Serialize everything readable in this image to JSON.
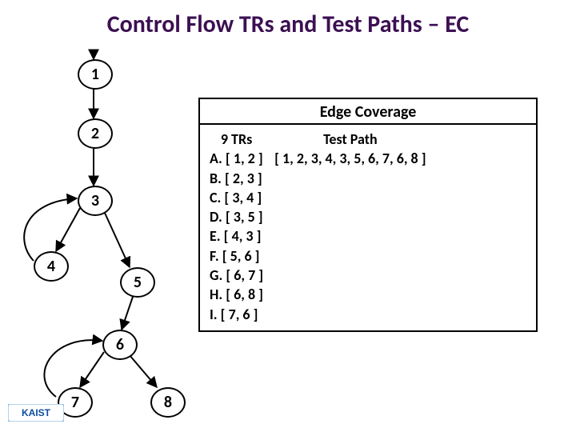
{
  "title": "Control Flow TRs and Test Paths – EC",
  "nodes": {
    "n1": "1",
    "n2": "2",
    "n3": "3",
    "n4": "4",
    "n5": "5",
    "n6": "6",
    "n7": "7",
    "n8": "8"
  },
  "coverage": {
    "heading": "Edge Coverage",
    "trs_title": "9 TRs",
    "trs": [
      "A. [ 1, 2 ]",
      "B. [ 2, 3 ]",
      "C. [ 3, 4 ]",
      "D. [ 3, 5 ]",
      "E. [ 4, 3 ]",
      "F. [ 5, 6 ]",
      "G. [ 6, 7 ]",
      "H. [ 6, 8 ]",
      "I. [ 7, 6 ]"
    ],
    "testpath_title": "Test Path",
    "testpath": "[ 1, 2, 3, 4, 3, 5, 6, 7, 6, 8 ]"
  },
  "logo_text": "KAIST",
  "chart_data": {
    "type": "graph",
    "title": "Control Flow Graph with Edge Coverage",
    "nodes": [
      1,
      2,
      3,
      4,
      5,
      6,
      7,
      8
    ],
    "edges": [
      [
        1,
        2
      ],
      [
        2,
        3
      ],
      [
        3,
        4
      ],
      [
        3,
        5
      ],
      [
        4,
        3
      ],
      [
        5,
        6
      ],
      [
        6,
        7
      ],
      [
        6,
        8
      ],
      [
        7,
        6
      ]
    ],
    "test_requirements": [
      [
        1,
        2
      ],
      [
        2,
        3
      ],
      [
        3,
        4
      ],
      [
        3,
        5
      ],
      [
        4,
        3
      ],
      [
        5,
        6
      ],
      [
        6,
        7
      ],
      [
        6,
        8
      ],
      [
        7,
        6
      ]
    ],
    "test_paths": [
      [
        1,
        2,
        3,
        4,
        3,
        5,
        6,
        7,
        6,
        8
      ]
    ]
  }
}
